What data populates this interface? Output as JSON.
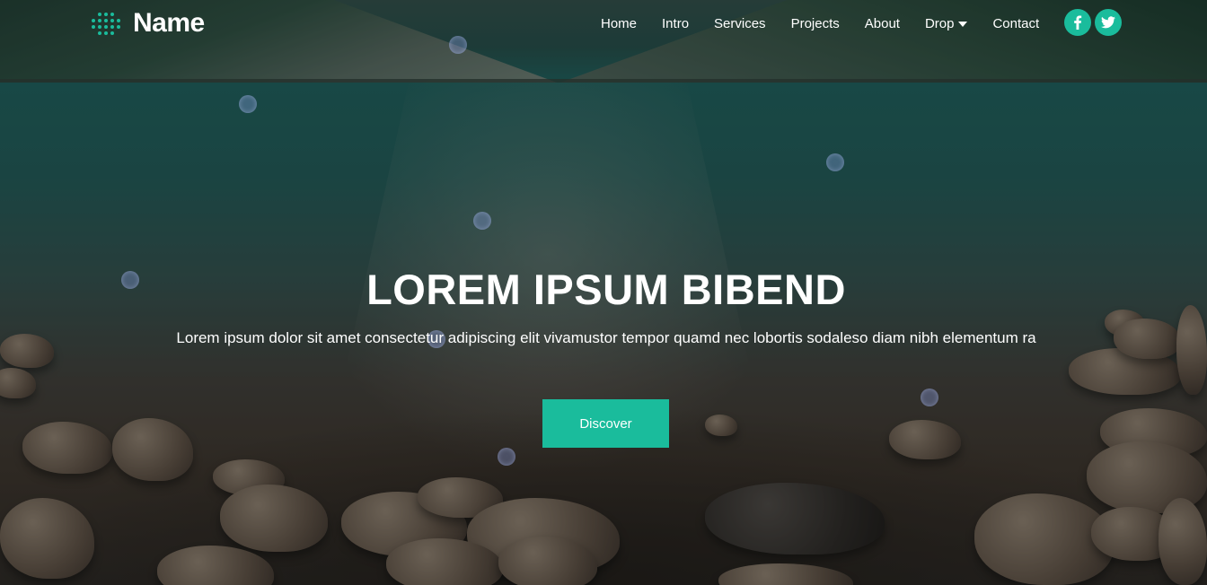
{
  "brand": {
    "name": "Name",
    "logo_icon": "dot-grid-logo-icon"
  },
  "nav": {
    "items": [
      {
        "label": "Home"
      },
      {
        "label": "Intro"
      },
      {
        "label": "Services"
      },
      {
        "label": "Projects"
      },
      {
        "label": "About"
      },
      {
        "label": "Drop",
        "icon": "caret-down-icon"
      },
      {
        "label": "Contact"
      }
    ]
  },
  "social": [
    {
      "icon": "facebook-icon",
      "color": "#1abc9c"
    },
    {
      "icon": "twitter-icon",
      "color": "#1abc9c"
    }
  ],
  "hero": {
    "title": "LOREM IPSUM BIBEND",
    "subtitle": "Lorem ipsum dolor sit amet consectetur adipiscing elit vivamustor tempor quamd nec lobortis sodaleso diam nibh elementum ra",
    "cta_label": "Discover"
  },
  "colors": {
    "accent": "#1abc9c",
    "text": "#ffffff"
  }
}
